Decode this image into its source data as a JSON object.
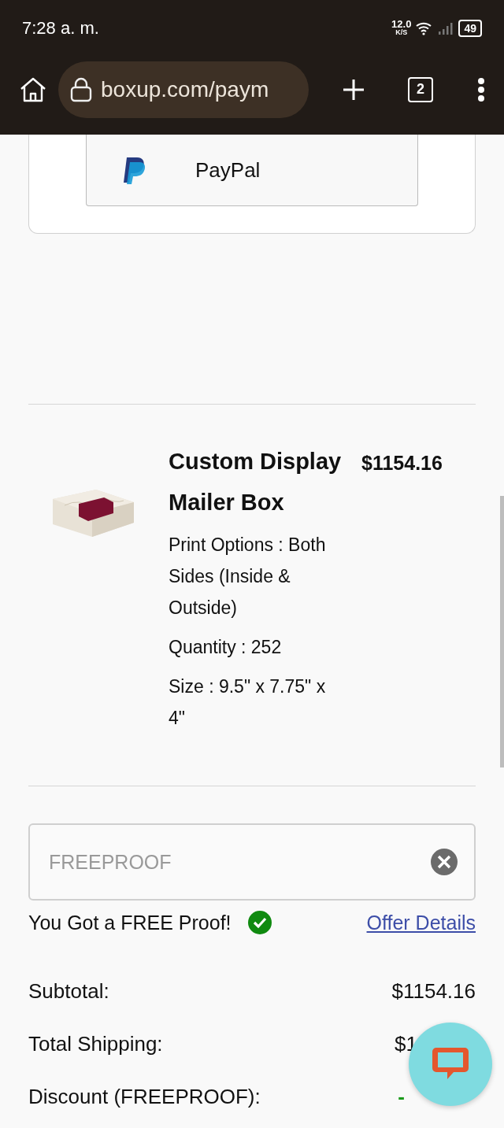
{
  "status_bar": {
    "time": "7:28 a. m.",
    "net_speed": "12.0",
    "net_unit": "K/S",
    "battery": "49"
  },
  "browser": {
    "url": "boxup.com/paym",
    "tab_count": "2"
  },
  "payment": {
    "method_label": "PayPal"
  },
  "product": {
    "name": "Custom Display Mailer Box",
    "price": "$1154.16",
    "details": [
      "Print Options : Both Sides (Inside & Outside)",
      "Quantity : 252",
      "Size : 9.5\" x 7.75\" x 4\""
    ]
  },
  "coupon": {
    "value": "FREEPROOF",
    "disabled": true,
    "applied": true,
    "message": "You Got a FREE Proof!",
    "link": "Offer Details"
  },
  "totals": [
    {
      "label": "Subtotal:",
      "value": "$1154.16",
      "kind": "plain"
    },
    {
      "label": "Total Shipping:",
      "value": "$1",
      "kind": "plain"
    },
    {
      "label": "Discount (FREEPROOF):",
      "value": "-",
      "kind": "discount"
    }
  ]
}
